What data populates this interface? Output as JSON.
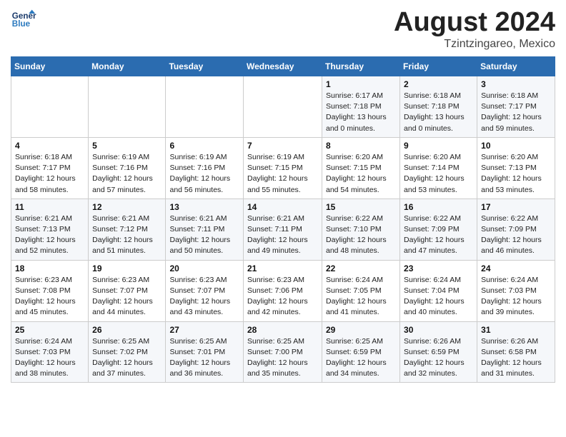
{
  "logo": {
    "line1": "General",
    "line2": "Blue"
  },
  "title": "August 2024",
  "subtitle": "Tzintzingareo, Mexico",
  "days_of_week": [
    "Sunday",
    "Monday",
    "Tuesday",
    "Wednesday",
    "Thursday",
    "Friday",
    "Saturday"
  ],
  "weeks": [
    [
      {
        "day": "",
        "info": ""
      },
      {
        "day": "",
        "info": ""
      },
      {
        "day": "",
        "info": ""
      },
      {
        "day": "",
        "info": ""
      },
      {
        "day": "1",
        "info": "Sunrise: 6:17 AM\nSunset: 7:18 PM\nDaylight: 13 hours\nand 0 minutes."
      },
      {
        "day": "2",
        "info": "Sunrise: 6:18 AM\nSunset: 7:18 PM\nDaylight: 13 hours\nand 0 minutes."
      },
      {
        "day": "3",
        "info": "Sunrise: 6:18 AM\nSunset: 7:17 PM\nDaylight: 12 hours\nand 59 minutes."
      }
    ],
    [
      {
        "day": "4",
        "info": "Sunrise: 6:18 AM\nSunset: 7:17 PM\nDaylight: 12 hours\nand 58 minutes."
      },
      {
        "day": "5",
        "info": "Sunrise: 6:19 AM\nSunset: 7:16 PM\nDaylight: 12 hours\nand 57 minutes."
      },
      {
        "day": "6",
        "info": "Sunrise: 6:19 AM\nSunset: 7:16 PM\nDaylight: 12 hours\nand 56 minutes."
      },
      {
        "day": "7",
        "info": "Sunrise: 6:19 AM\nSunset: 7:15 PM\nDaylight: 12 hours\nand 55 minutes."
      },
      {
        "day": "8",
        "info": "Sunrise: 6:20 AM\nSunset: 7:15 PM\nDaylight: 12 hours\nand 54 minutes."
      },
      {
        "day": "9",
        "info": "Sunrise: 6:20 AM\nSunset: 7:14 PM\nDaylight: 12 hours\nand 53 minutes."
      },
      {
        "day": "10",
        "info": "Sunrise: 6:20 AM\nSunset: 7:13 PM\nDaylight: 12 hours\nand 53 minutes."
      }
    ],
    [
      {
        "day": "11",
        "info": "Sunrise: 6:21 AM\nSunset: 7:13 PM\nDaylight: 12 hours\nand 52 minutes."
      },
      {
        "day": "12",
        "info": "Sunrise: 6:21 AM\nSunset: 7:12 PM\nDaylight: 12 hours\nand 51 minutes."
      },
      {
        "day": "13",
        "info": "Sunrise: 6:21 AM\nSunset: 7:11 PM\nDaylight: 12 hours\nand 50 minutes."
      },
      {
        "day": "14",
        "info": "Sunrise: 6:21 AM\nSunset: 7:11 PM\nDaylight: 12 hours\nand 49 minutes."
      },
      {
        "day": "15",
        "info": "Sunrise: 6:22 AM\nSunset: 7:10 PM\nDaylight: 12 hours\nand 48 minutes."
      },
      {
        "day": "16",
        "info": "Sunrise: 6:22 AM\nSunset: 7:09 PM\nDaylight: 12 hours\nand 47 minutes."
      },
      {
        "day": "17",
        "info": "Sunrise: 6:22 AM\nSunset: 7:09 PM\nDaylight: 12 hours\nand 46 minutes."
      }
    ],
    [
      {
        "day": "18",
        "info": "Sunrise: 6:23 AM\nSunset: 7:08 PM\nDaylight: 12 hours\nand 45 minutes."
      },
      {
        "day": "19",
        "info": "Sunrise: 6:23 AM\nSunset: 7:07 PM\nDaylight: 12 hours\nand 44 minutes."
      },
      {
        "day": "20",
        "info": "Sunrise: 6:23 AM\nSunset: 7:07 PM\nDaylight: 12 hours\nand 43 minutes."
      },
      {
        "day": "21",
        "info": "Sunrise: 6:23 AM\nSunset: 7:06 PM\nDaylight: 12 hours\nand 42 minutes."
      },
      {
        "day": "22",
        "info": "Sunrise: 6:24 AM\nSunset: 7:05 PM\nDaylight: 12 hours\nand 41 minutes."
      },
      {
        "day": "23",
        "info": "Sunrise: 6:24 AM\nSunset: 7:04 PM\nDaylight: 12 hours\nand 40 minutes."
      },
      {
        "day": "24",
        "info": "Sunrise: 6:24 AM\nSunset: 7:03 PM\nDaylight: 12 hours\nand 39 minutes."
      }
    ],
    [
      {
        "day": "25",
        "info": "Sunrise: 6:24 AM\nSunset: 7:03 PM\nDaylight: 12 hours\nand 38 minutes."
      },
      {
        "day": "26",
        "info": "Sunrise: 6:25 AM\nSunset: 7:02 PM\nDaylight: 12 hours\nand 37 minutes."
      },
      {
        "day": "27",
        "info": "Sunrise: 6:25 AM\nSunset: 7:01 PM\nDaylight: 12 hours\nand 36 minutes."
      },
      {
        "day": "28",
        "info": "Sunrise: 6:25 AM\nSunset: 7:00 PM\nDaylight: 12 hours\nand 35 minutes."
      },
      {
        "day": "29",
        "info": "Sunrise: 6:25 AM\nSunset: 6:59 PM\nDaylight: 12 hours\nand 34 minutes."
      },
      {
        "day": "30",
        "info": "Sunrise: 6:26 AM\nSunset: 6:59 PM\nDaylight: 12 hours\nand 32 minutes."
      },
      {
        "day": "31",
        "info": "Sunrise: 6:26 AM\nSunset: 6:58 PM\nDaylight: 12 hours\nand 31 minutes."
      }
    ]
  ]
}
